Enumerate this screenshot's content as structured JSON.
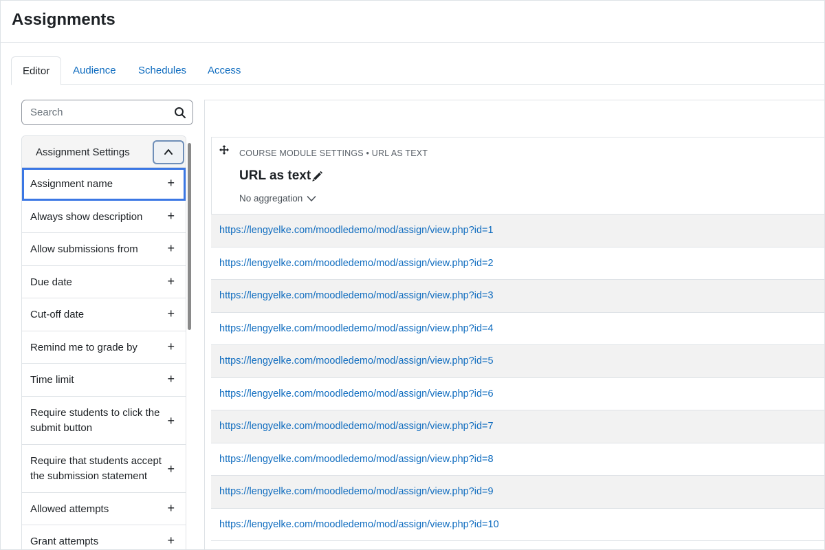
{
  "page": {
    "title": "Assignments"
  },
  "tabs": [
    {
      "label": "Editor"
    },
    {
      "label": "Audience"
    },
    {
      "label": "Schedules"
    },
    {
      "label": "Access"
    }
  ],
  "sidebar": {
    "search_placeholder": "Search",
    "section_label": "Assignment Settings",
    "items": [
      {
        "label": "Assignment name"
      },
      {
        "label": "Always show description"
      },
      {
        "label": "Allow submissions from"
      },
      {
        "label": "Due date"
      },
      {
        "label": "Cut-off date"
      },
      {
        "label": "Remind me to grade by"
      },
      {
        "label": "Time limit"
      },
      {
        "label": "Require students to click the submit button"
      },
      {
        "label": "Require that students accept the submission statement"
      },
      {
        "label": "Allowed attempts"
      },
      {
        "label": "Grant attempts"
      }
    ],
    "plus_symbol": "+"
  },
  "column": {
    "breadcrumb": "COURSE MODULE SETTINGS • URL AS TEXT",
    "title": "URL as text",
    "aggregation": "No aggregation"
  },
  "rows": [
    "https://lengyelke.com/moodledemo/mod/assign/view.php?id=1",
    "https://lengyelke.com/moodledemo/mod/assign/view.php?id=2",
    "https://lengyelke.com/moodledemo/mod/assign/view.php?id=3",
    "https://lengyelke.com/moodledemo/mod/assign/view.php?id=4",
    "https://lengyelke.com/moodledemo/mod/assign/view.php?id=5",
    "https://lengyelke.com/moodledemo/mod/assign/view.php?id=6",
    "https://lengyelke.com/moodledemo/mod/assign/view.php?id=7",
    "https://lengyelke.com/moodledemo/mod/assign/view.php?id=8",
    "https://lengyelke.com/moodledemo/mod/assign/view.php?id=9",
    "https://lengyelke.com/moodledemo/mod/assign/view.php?id=10"
  ],
  "colors": {
    "link": "#0f6cbf",
    "focus_outline": "#3b77e4",
    "row_stripe": "#f2f2f2"
  }
}
